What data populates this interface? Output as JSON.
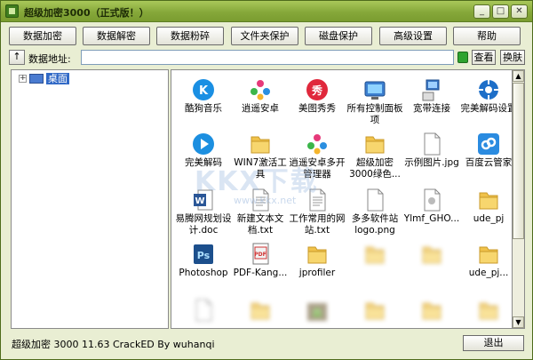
{
  "window": {
    "title": "超级加密3000（正式版！）",
    "minimize": "_",
    "maximize": "□",
    "close": "✕"
  },
  "toolbar": [
    "数据加密",
    "数据解密",
    "数据粉碎",
    "文件夹保护",
    "磁盘保护",
    "高级设置",
    "帮助"
  ],
  "address": {
    "up": "↑",
    "label": "数据地址:",
    "value": "",
    "view_button": "查看",
    "switch_button": "换肤"
  },
  "tree": {
    "expander": "+",
    "root_label": "桌面"
  },
  "files": [
    {
      "name": "酷狗音乐",
      "icon": "kugou-icon",
      "color": "#1a8fe3"
    },
    {
      "name": "逍遥安卓",
      "icon": "xiaoyao-icon",
      "color": "#e63a7a"
    },
    {
      "name": "美图秀秀",
      "icon": "meitu-icon",
      "color": "#e0283c"
    },
    {
      "name": "所有控制面板项",
      "icon": "control-panel-icon",
      "color": "#3c7fd0"
    },
    {
      "name": "宽带连接",
      "icon": "network-icon",
      "color": "#3a76c4"
    },
    {
      "name": "完美解码设置",
      "icon": "gear-icon",
      "color": "#1e6fc8"
    },
    {
      "name": "完美解码",
      "icon": "player-icon",
      "color": "#1c8fe0"
    },
    {
      "name": "WIN7激活工具",
      "icon": "folder-icon",
      "color": "#f0c24a"
    },
    {
      "name": "逍遥安卓多开管理器",
      "icon": "xiaoyao-icon",
      "color": "#e63a7a"
    },
    {
      "name": "超级加密3000绿色...",
      "icon": "folder-icon",
      "color": "#f0c24a"
    },
    {
      "name": "示例图片.jpg",
      "icon": "document-icon",
      "color": "#ffffff"
    },
    {
      "name": "百度云管家",
      "icon": "cloud-icon",
      "color": "#2a8be0"
    },
    {
      "name": "易腾网规划设计.doc",
      "icon": "word-icon",
      "color": "#2b5797"
    },
    {
      "name": "新建文本文档.txt",
      "icon": "text-file-icon",
      "color": "#ffffff"
    },
    {
      "name": "工作常用的网站.txt",
      "icon": "text-file-icon",
      "color": "#ffffff"
    },
    {
      "name": "多多软件站logo.png",
      "icon": "document-icon",
      "color": "#ffffff"
    },
    {
      "name": "Ylmf_GHO...",
      "icon": "ghost-file-icon",
      "color": "#e8e8e8"
    },
    {
      "name": "ude_pj",
      "icon": "folder-icon",
      "color": "#f0c24a"
    },
    {
      "name": "Photoshop",
      "icon": "photoshop-icon",
      "color": "#1c4f8c"
    },
    {
      "name": "PDF-Kang...",
      "icon": "pdf-icon",
      "color": "#d03030"
    },
    {
      "name": "jprofiler",
      "icon": "folder-icon",
      "color": "#f0c24a"
    },
    {
      "name": "",
      "icon": "folder-icon",
      "color": "#f0c24a"
    },
    {
      "name": "",
      "icon": "folder-icon",
      "color": "#f0c24a"
    },
    {
      "name": "ude_pj...",
      "icon": "folder-icon",
      "color": "#f0c24a"
    },
    {
      "name": "",
      "icon": "document-icon",
      "color": "#ffffff"
    },
    {
      "name": "",
      "icon": "folder-icon",
      "color": "#f0c24a"
    },
    {
      "name": "",
      "icon": "android-icon",
      "color": "#6ca33a"
    },
    {
      "name": "",
      "icon": "folder-icon",
      "color": "#f0c24a"
    },
    {
      "name": "",
      "icon": "folder-icon",
      "color": "#f0c24a"
    },
    {
      "name": "",
      "icon": "folder-icon",
      "color": "#f0c24a"
    }
  ],
  "watermark": {
    "main": "KKX下载",
    "url": "www.kkx.net"
  },
  "status": {
    "text": "超级加密 3000 11.63  CrackED By wuhanqi",
    "exit": "退出"
  }
}
